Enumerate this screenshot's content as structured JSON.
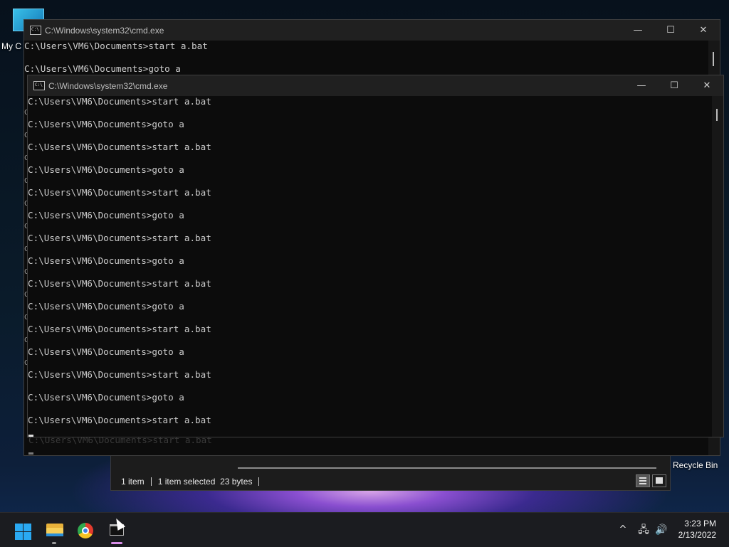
{
  "desktop": {
    "icons": [
      {
        "label": "My C"
      },
      {
        "label": "Recycle Bin"
      }
    ]
  },
  "explorer": {
    "status_items": "1 item",
    "status_selected": "1 item selected",
    "status_size": "23 bytes"
  },
  "cmd_back": {
    "title": "C:\\Windows\\system32\\cmd.exe",
    "icon_text": "C:\\",
    "lines": [
      "C:\\Users\\VM6\\Documents>start a.bat",
      "C:\\Users\\VM6\\Documents>goto a"
    ],
    "ghost_line": "C:\\Users\\VM6\\Documents>start a.bat"
  },
  "cmd_front": {
    "title": "C:\\Windows\\system32\\cmd.exe",
    "icon_text": "C:\\",
    "lines": [
      "C:\\Users\\VM6\\Documents>start a.bat",
      "C:\\Users\\VM6\\Documents>goto a",
      "C:\\Users\\VM6\\Documents>start a.bat",
      "C:\\Users\\VM6\\Documents>goto a",
      "C:\\Users\\VM6\\Documents>start a.bat",
      "C:\\Users\\VM6\\Documents>goto a",
      "C:\\Users\\VM6\\Documents>start a.bat",
      "C:\\Users\\VM6\\Documents>goto a",
      "C:\\Users\\VM6\\Documents>start a.bat",
      "C:\\Users\\VM6\\Documents>goto a",
      "C:\\Users\\VM6\\Documents>start a.bat",
      "C:\\Users\\VM6\\Documents>goto a",
      "C:\\Users\\VM6\\Documents>start a.bat",
      "C:\\Users\\VM6\\Documents>goto a",
      "C:\\Users\\VM6\\Documents>start a.bat"
    ],
    "left_slice_char": "C"
  },
  "window_controls": {
    "minimize": "—",
    "maximize": "☐",
    "close": "✕"
  },
  "taskbar": {
    "apps": [
      {
        "name": "start",
        "icon": "windows-logo-icon"
      },
      {
        "name": "file-explorer",
        "icon": "folder-icon"
      },
      {
        "name": "chrome",
        "icon": "chrome-icon"
      },
      {
        "name": "command-prompt",
        "icon": "cmd-icon"
      }
    ],
    "tray": {
      "chevron": "^",
      "network": "🖧",
      "volume": "🔊"
    },
    "clock": {
      "time": "3:23 PM",
      "date": "2/13/2022"
    }
  },
  "colors": {
    "accent": "#2aa9f2",
    "terminal_bg": "#0c0c0c",
    "terminal_fg": "#cccccc",
    "titlebar": "#202020",
    "taskbar": "#1b1c20"
  }
}
